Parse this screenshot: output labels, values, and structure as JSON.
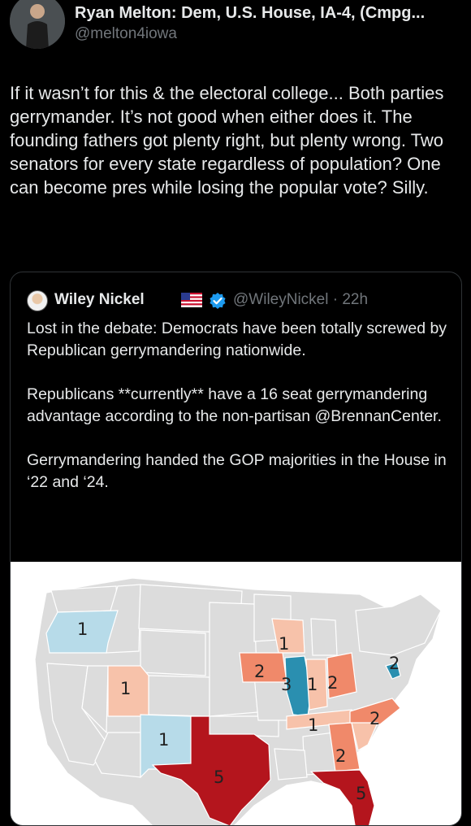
{
  "tweet": {
    "author_name": "Ryan Melton: Dem, U.S. House, IA-4, (Cmpg...",
    "author_handle": "@melton4iowa",
    "text": "If it wasn’t for this & the electoral college... Both parties gerrymander. It’s not good when either does it. The founding fathers got plenty right, but plenty wrong. Two senators for every state regardless of population? One can become pres while losing the popular vote? Silly."
  },
  "quote": {
    "author_name": "Wiley Nickel",
    "handle_time": "@WileyNickel · 22h",
    "paragraphs": [
      "Lost in the debate: Democrats have been totally screwed by Republican gerrymandering nationwide.",
      "Republicans **currently** have a 16 seat gerrymandering advantage according to the non-partisan @BrennanCenter.",
      "Gerrymandering handed the GOP majorities in the House in ‘22 and ‘24."
    ]
  },
  "map": {
    "colors": {
      "dem_light": "#b7dbe9",
      "dem_dark": "#2a8fb0",
      "rep_light": "#f7c2aa",
      "rep_mid": "#f0896a",
      "rep_dark": "#b4151d",
      "neutral": "#dcdcdc"
    },
    "seat_labels": {
      "oregon": "1",
      "utah": "1",
      "new_mexico": "1",
      "texas": "5",
      "wisconsin": "1",
      "iowa": "2",
      "illinois": "3",
      "indiana": "1",
      "ohio": "2",
      "maryland": "2",
      "tennessee": "1",
      "north_carolina": "2",
      "georgia": "2",
      "florida": "5"
    }
  }
}
